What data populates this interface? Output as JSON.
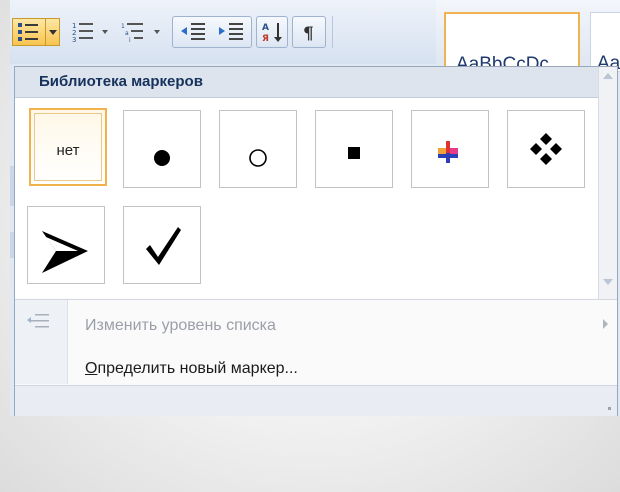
{
  "ribbon": {
    "style_sample": "AaBbCcDc",
    "style_sample_2": "Aa"
  },
  "dropdown": {
    "library_title": "Библиотека маркеров",
    "bullets": [
      {
        "name": "none",
        "label": "нет",
        "selected": true
      },
      {
        "name": "filled-circle",
        "label": "",
        "selected": false
      },
      {
        "name": "hollow-circle",
        "label": "",
        "selected": false
      },
      {
        "name": "filled-square",
        "label": "",
        "selected": false
      },
      {
        "name": "color-cross",
        "label": "",
        "selected": false
      },
      {
        "name": "four-diamonds",
        "label": "",
        "selected": false
      },
      {
        "name": "arrowhead",
        "label": "",
        "selected": false
      },
      {
        "name": "checkmark",
        "label": "",
        "selected": false
      }
    ],
    "change_level_label": "Изменить уровень списка",
    "change_level_enabled": false,
    "define_new_first": "О",
    "define_new_rest": "пределить новый маркер..."
  },
  "colors": {
    "selected_border": "#f0b24a",
    "header_text": "#16325c",
    "disabled_text": "#9a9fa8",
    "ribbon_bg": "#dfe8f5"
  }
}
